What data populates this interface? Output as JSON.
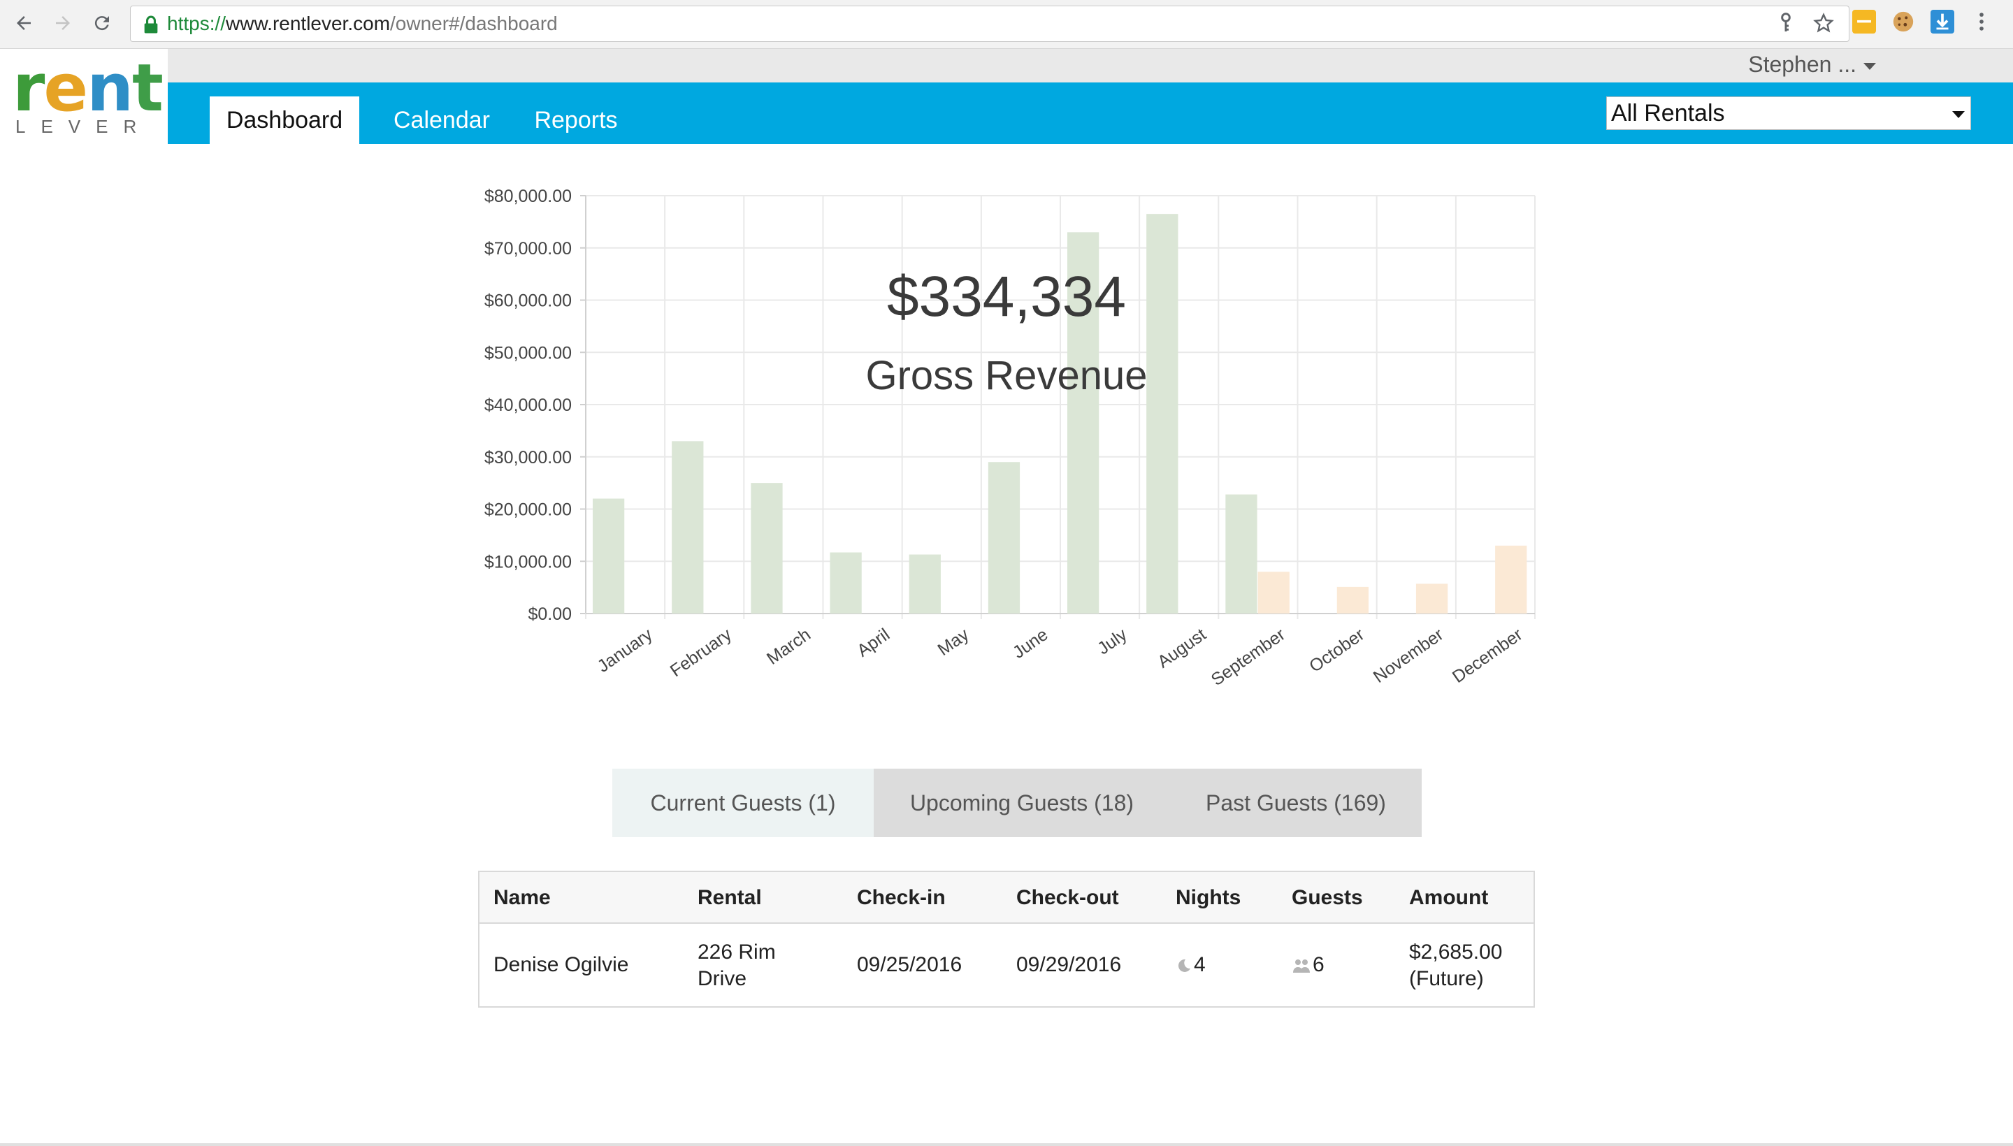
{
  "browser": {
    "url_protocol": "https://",
    "url_host": "www.rentlever.com",
    "url_path": "/owner#/dashboard"
  },
  "brand": {
    "logo_top": "rent",
    "logo_bottom": "LEVER"
  },
  "header": {
    "user_name": "Stephen ...",
    "tabs": [
      {
        "label": "Dashboard",
        "active": true
      },
      {
        "label": "Calendar",
        "active": false
      },
      {
        "label": "Reports",
        "active": false
      }
    ],
    "rental_filter": "All Rentals"
  },
  "summary": {
    "total": "$334,334",
    "caption": "Gross Revenue"
  },
  "colors": {
    "nav": "#00a8e0",
    "actual_bar": "#dbe6d6",
    "future_bar": "#fbe9d5",
    "grid": "#e9e9e9"
  },
  "chart_data": {
    "type": "bar",
    "categories": [
      "January",
      "February",
      "March",
      "April",
      "May",
      "June",
      "July",
      "August",
      "September",
      "October",
      "November",
      "December"
    ],
    "series": [
      {
        "values": [
          22000,
          33000,
          25000,
          11700,
          11300,
          29000,
          73000,
          76500,
          22800,
          0,
          0,
          0
        ]
      },
      {
        "values": [
          0,
          0,
          0,
          0,
          0,
          0,
          0,
          0,
          8000,
          5100,
          5700,
          13000
        ]
      }
    ],
    "ylim": [
      0,
      80000
    ],
    "yticks": [
      "$0.00",
      "$10,000.00",
      "$20,000.00",
      "$30,000.00",
      "$40,000.00",
      "$50,000.00",
      "$60,000.00",
      "$70,000.00",
      "$80,000.00"
    ],
    "grid": true
  },
  "guest_tabs": [
    {
      "label": "Current Guests (1)",
      "active": true
    },
    {
      "label": "Upcoming Guests (18)",
      "active": false
    },
    {
      "label": "Past Guests (169)",
      "active": false
    }
  ],
  "table": {
    "columns": [
      "Name",
      "Rental",
      "Check-in",
      "Check-out",
      "Nights",
      "Guests",
      "Amount"
    ],
    "rows": [
      {
        "name": "Denise Ogilvie",
        "rental_line1": "226 Rim",
        "rental_line2": "Drive",
        "checkin": "09/25/2016",
        "checkout": "09/29/2016",
        "nights": "4",
        "guests": "6",
        "amount_line1": "$2,685.00",
        "amount_line2": "(Future)"
      }
    ]
  }
}
